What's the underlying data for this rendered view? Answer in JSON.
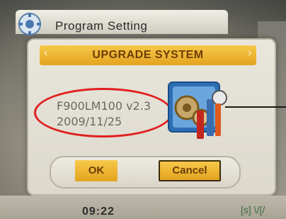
{
  "background": {
    "window_title": "Program Setting"
  },
  "dialog": {
    "title": "UPGRADE SYSTEM",
    "left_arrow": "‹",
    "right_arrow": "›",
    "version": "F900LM100 v2.3",
    "date": "2009/11/25",
    "ok_label": "OK",
    "cancel_label": "Cancel",
    "icon": "upgrade-tools-icon"
  },
  "status_bar": {
    "time": "09:22",
    "icons": "[s] \\/[/"
  },
  "colors": {
    "accent": "#e3a41f",
    "highlight": "#e0201f"
  }
}
